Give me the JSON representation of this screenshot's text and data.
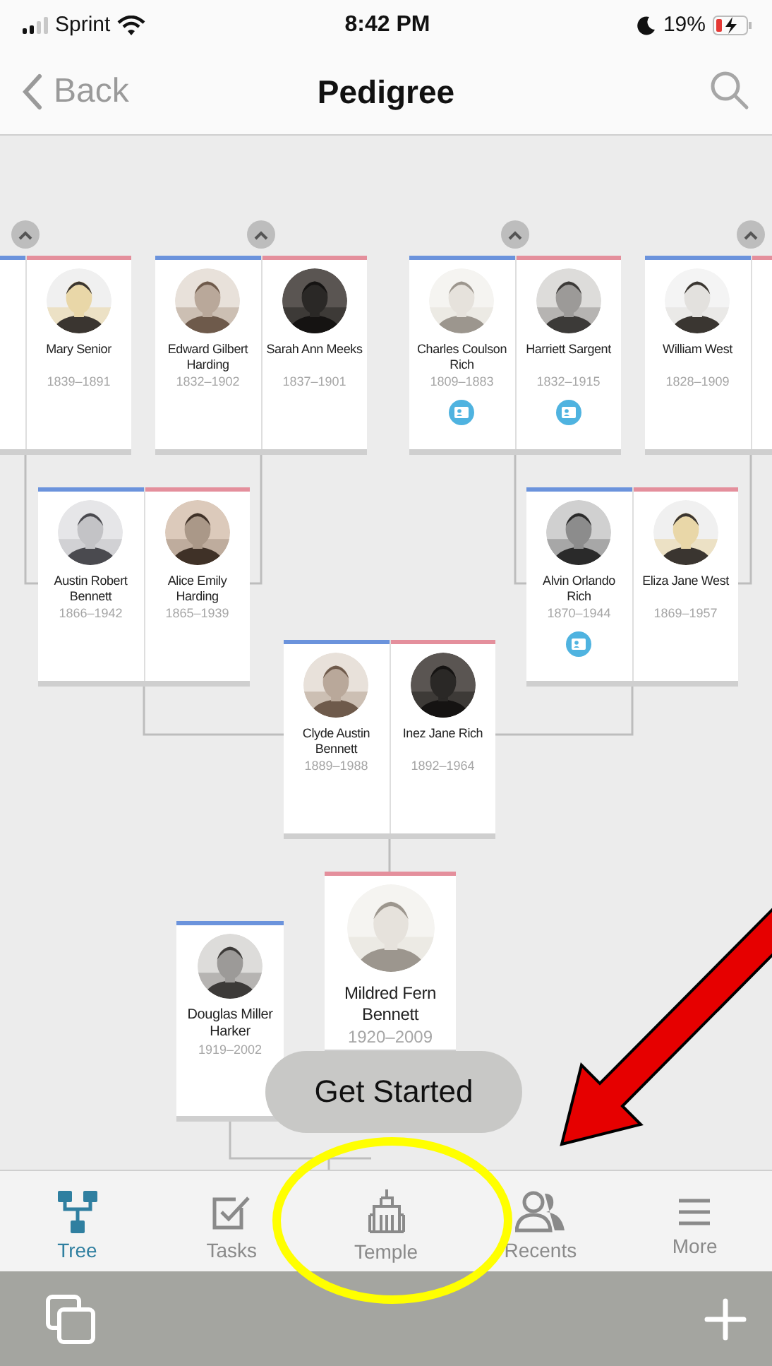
{
  "status_bar": {
    "carrier": "Sprint",
    "time": "8:42 PM",
    "battery": "19%"
  },
  "nav": {
    "back": "Back",
    "title": "Pedigree"
  },
  "tree": {
    "couples": [
      {
        "kind": "couple",
        "collapse_button": true,
        "people": [
          {
            "color": "#6b93dc",
            "record_icon": false
          },
          {
            "name": "Mary Senior",
            "years": "1839–1891",
            "color": "#e48f9c",
            "record_icon": false
          }
        ]
      },
      {
        "kind": "couple",
        "collapse_button": true,
        "people": [
          {
            "name": "Edward Gilbert Harding",
            "years": "1832–1902",
            "color": "#6b93dc",
            "record_icon": false
          },
          {
            "name": "Sarah Ann Meeks",
            "years": "1837–1901",
            "color": "#e48f9c",
            "record_icon": false
          }
        ]
      },
      {
        "kind": "couple",
        "collapse_button": true,
        "people": [
          {
            "name": "Charles Coulson Rich",
            "years": "1809–1883",
            "color": "#6b93dc",
            "record_icon": true
          },
          {
            "name": "Harriett Sargent",
            "years": "1832–1915",
            "color": "#e48f9c",
            "record_icon": true
          }
        ]
      },
      {
        "kind": "couple",
        "collapse_button": true,
        "people": [
          {
            "name": "William West",
            "years": "1828–1909",
            "color": "#6b93dc",
            "record_icon": false
          },
          {
            "color": "#e48f9c",
            "record_icon": false
          }
        ]
      },
      {
        "kind": "couple",
        "collapse_button": false,
        "people": [
          {
            "name": "Austin Robert Bennett",
            "years": "1866–1942",
            "color": "#6b93dc",
            "record_icon": false
          },
          {
            "name": "Alice Emily Harding",
            "years": "1865–1939",
            "color": "#e48f9c",
            "record_icon": false
          }
        ]
      },
      {
        "kind": "couple",
        "collapse_button": false,
        "people": [
          {
            "name": "Alvin Orlando Rich",
            "years": "1870–1944",
            "color": "#6b93dc",
            "record_icon": true
          },
          {
            "name": "Eliza Jane West",
            "years": "1869–1957",
            "color": "#e48f9c",
            "record_icon": false
          }
        ]
      },
      {
        "kind": "couple",
        "collapse_button": false,
        "people": [
          {
            "name": "Clyde Austin Bennett",
            "years": "1889–1988",
            "color": "#6b93dc",
            "record_icon": false
          },
          {
            "name": "Inez Jane Rich",
            "years": "1892–1964",
            "color": "#e48f9c",
            "record_icon": false
          }
        ]
      },
      {
        "kind": "focus",
        "collapse_button": false,
        "people": [
          {
            "name": "Mildred Fern Bennett",
            "years": "1920–2009",
            "color": "#e48f9c",
            "record_icon": false
          }
        ]
      },
      {
        "kind": "single",
        "collapse_button": false,
        "people": [
          {
            "name": "Douglas Miller Harker",
            "years": "1919–2002",
            "color": "#6b93dc",
            "record_icon": false
          }
        ]
      }
    ]
  },
  "get_started": "Get Started",
  "tabs": [
    {
      "label": "Tree",
      "selected": true
    },
    {
      "label": "Tasks",
      "selected": false
    },
    {
      "label": "Temple",
      "selected": false
    },
    {
      "label": "Recents",
      "selected": false
    },
    {
      "label": "More",
      "selected": false
    }
  ],
  "annotations": {
    "ellipse": true,
    "arrow": true
  }
}
